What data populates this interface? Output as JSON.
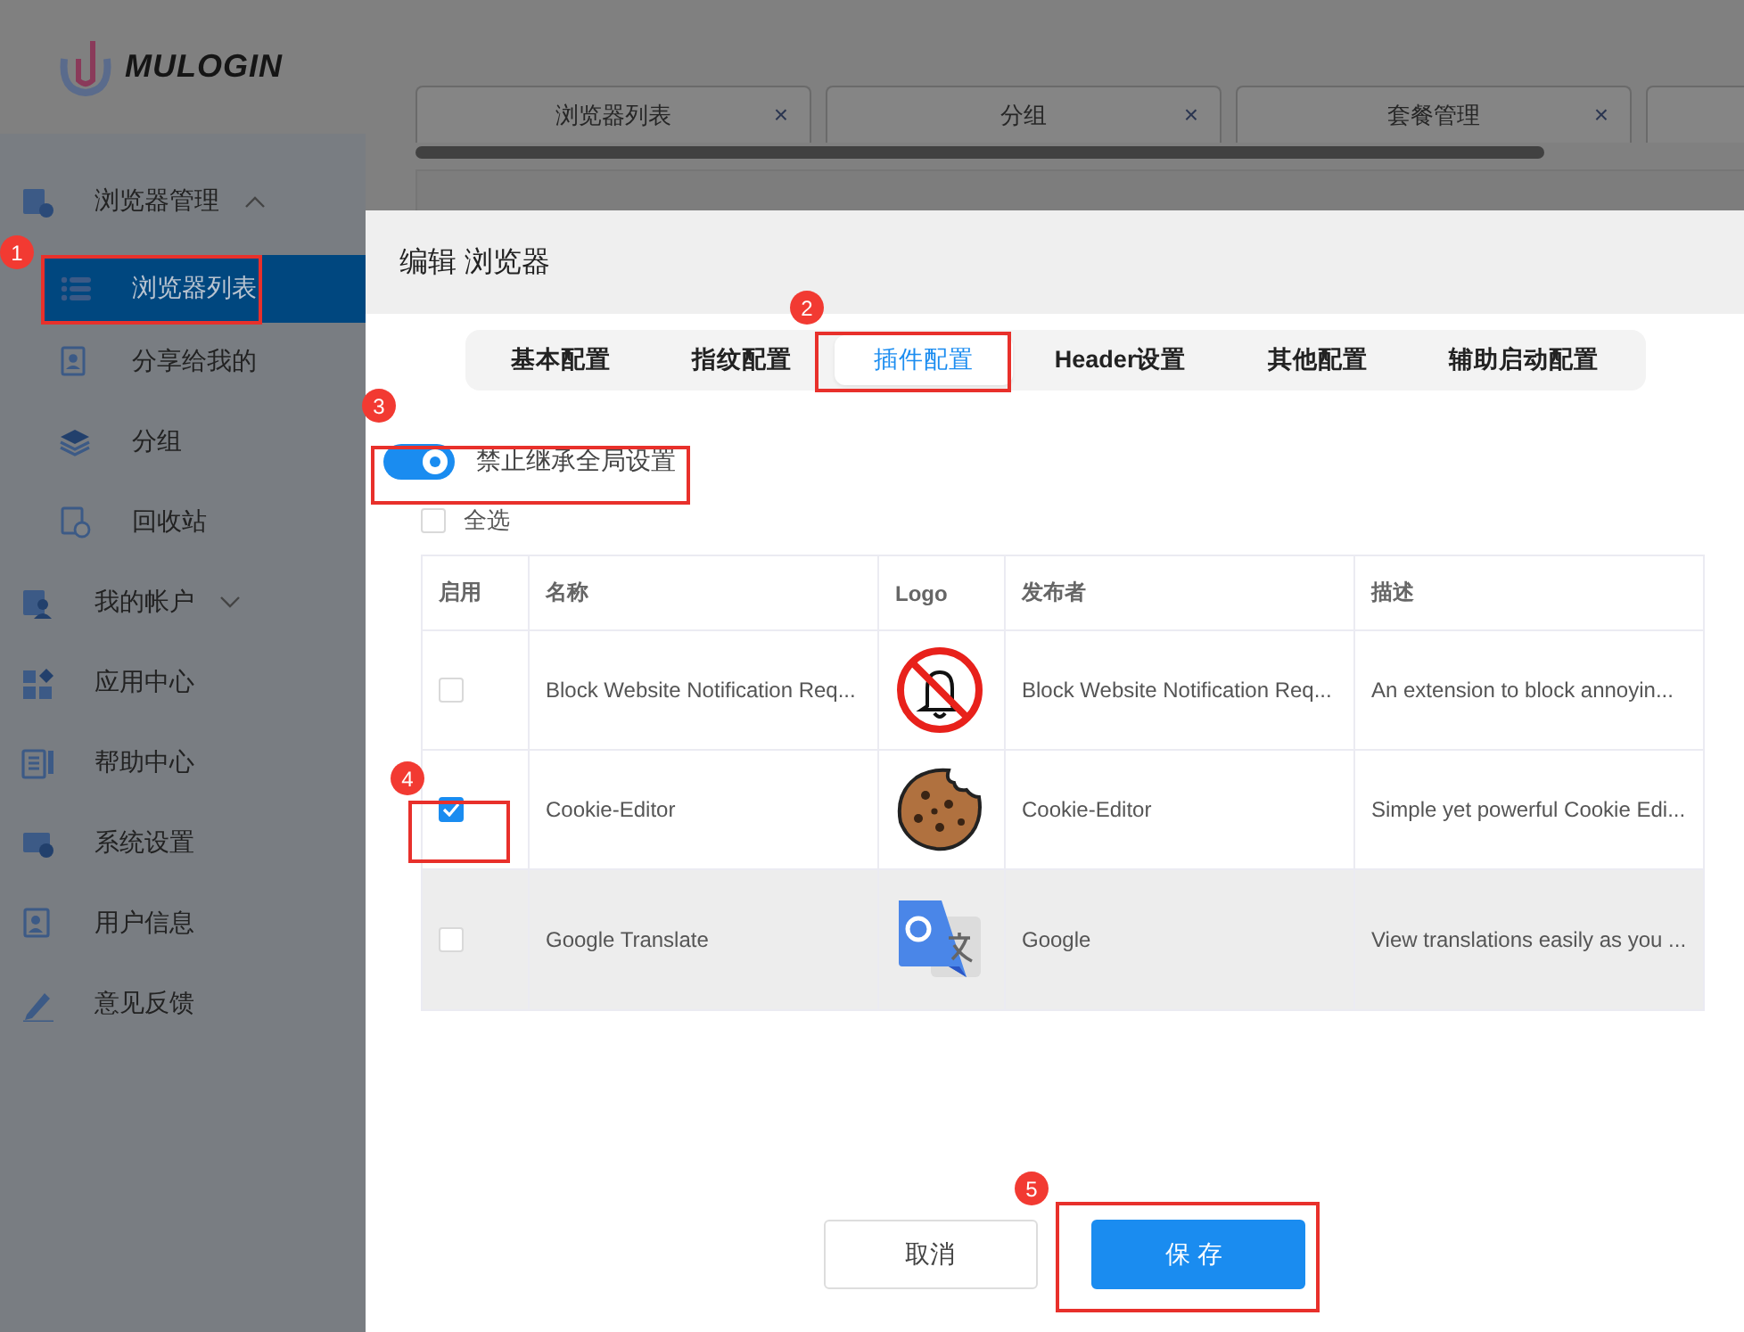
{
  "logo": {
    "text": "MULOGIN"
  },
  "sidebar": {
    "items": [
      {
        "label": "浏览器管理",
        "kind": "group",
        "expanded": true,
        "selected": false,
        "children": [
          {
            "label": "浏览器列表",
            "selected": true
          },
          {
            "label": "分享给我的",
            "selected": false
          },
          {
            "label": "分组",
            "selected": false
          },
          {
            "label": "回收站",
            "selected": false
          }
        ]
      },
      {
        "label": "我的帐户",
        "kind": "group",
        "expanded": false,
        "selected": false
      },
      {
        "label": "应用中心",
        "kind": "item",
        "selected": false
      },
      {
        "label": "帮助中心",
        "kind": "item",
        "selected": false
      },
      {
        "label": "系统设置",
        "kind": "item",
        "selected": false
      },
      {
        "label": "用户信息",
        "kind": "item",
        "selected": false
      },
      {
        "label": "意见反馈",
        "kind": "item",
        "selected": false
      }
    ]
  },
  "page_tabs": [
    {
      "label": "浏览器列表",
      "close": "×"
    },
    {
      "label": "分组",
      "close": "×"
    },
    {
      "label": "套餐管理",
      "close": "×"
    }
  ],
  "dialog": {
    "title": "编辑 浏览器",
    "tabs": [
      {
        "label": "基本配置",
        "selected": false
      },
      {
        "label": "指纹配置",
        "selected": false
      },
      {
        "label": "插件配置",
        "selected": true
      },
      {
        "label": "Header设置",
        "selected": false
      },
      {
        "label": "其他配置",
        "selected": false
      },
      {
        "label": "辅助启动配置",
        "selected": false
      }
    ],
    "toggle": {
      "label": "禁止继承全局设置",
      "on": true
    },
    "select_all": {
      "label": "全选",
      "checked": false
    },
    "table": {
      "columns": [
        "启用",
        "名称",
        "Logo",
        "发布者",
        "描述"
      ],
      "rows": [
        {
          "enabled": false,
          "hovered": false,
          "name": "Block Website Notification Req...",
          "publisher": "Block Website Notification Req...",
          "description": "An extension to block annoyin..."
        },
        {
          "enabled": true,
          "hovered": false,
          "name": "Cookie-Editor",
          "publisher": "Cookie-Editor",
          "description": "Simple yet powerful Cookie Edi..."
        },
        {
          "enabled": false,
          "hovered": true,
          "name": "Google Translate",
          "publisher": "Google",
          "description": "View translations easily as you ..."
        }
      ]
    },
    "buttons": [
      {
        "label": "取消",
        "kind": "secondary"
      },
      {
        "label": "保存",
        "kind": "primary"
      }
    ]
  },
  "annotations": [
    {
      "number": "1"
    },
    {
      "number": "2"
    },
    {
      "number": "3"
    },
    {
      "number": "4"
    },
    {
      "number": "5"
    }
  ]
}
